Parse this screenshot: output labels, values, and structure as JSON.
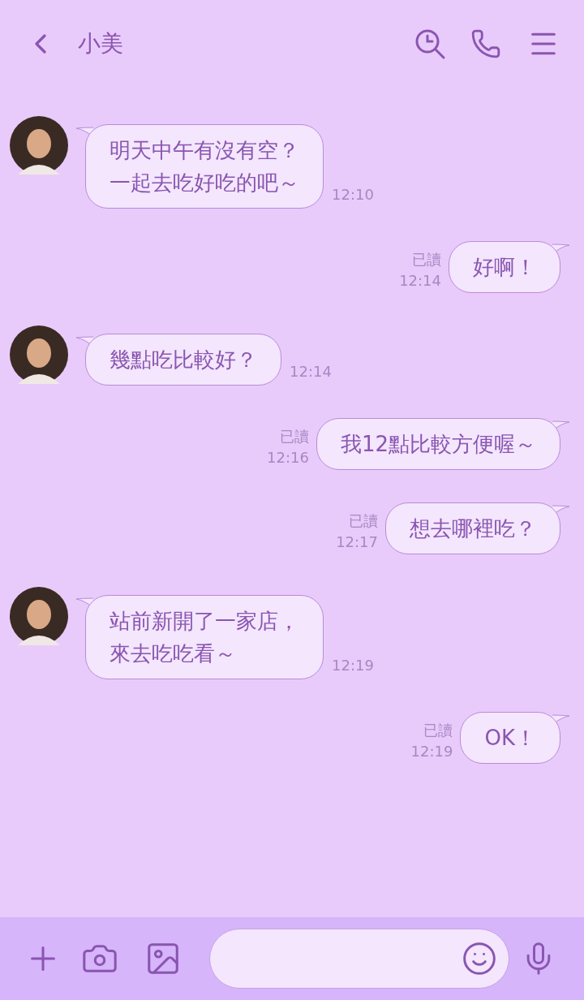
{
  "header": {
    "title": "小美"
  },
  "messages": [
    {
      "kind": "incoming",
      "lines": [
        "明天中午有沒有空？",
        "一起去吃好吃的吧～"
      ],
      "time": "12:10"
    },
    {
      "kind": "outgoing",
      "lines": [
        "好啊！"
      ],
      "read": "已讀",
      "time": "12:14"
    },
    {
      "kind": "incoming",
      "lines": [
        "幾點吃比較好？"
      ],
      "time": "12:14"
    },
    {
      "kind": "outgoing",
      "lines": [
        "我12點比較方便喔～"
      ],
      "read": "已讀",
      "time": "12:16"
    },
    {
      "kind": "outgoing",
      "lines": [
        "想去哪裡吃？"
      ],
      "read": "已讀",
      "time": "12:17"
    },
    {
      "kind": "incoming",
      "lines": [
        "站前新開了一家店，",
        "來去吃吃看～"
      ],
      "time": "12:19"
    },
    {
      "kind": "outgoing",
      "lines": [
        "OK！"
      ],
      "read": "已讀",
      "time": "12:19"
    }
  ]
}
